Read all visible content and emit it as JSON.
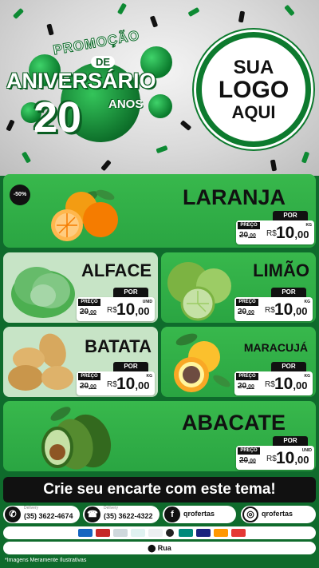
{
  "header": {
    "promo_title": "PROMOÇÃO",
    "promo_de": "DE",
    "promo_main": "ANIVERSÁRIO",
    "promo_number": "20",
    "promo_anos": "ANOS",
    "logo_line1": "SUA",
    "logo_line2": "LOGO",
    "logo_line3": "AQUI"
  },
  "products": [
    {
      "name": "LARANJA",
      "badge": "-50%",
      "por": "POR",
      "preco": "PREÇO",
      "old_price": "20",
      "old_cents": ",00",
      "currency": "R$",
      "price": "10",
      "cents": ",00",
      "unit": "KG"
    },
    {
      "name": "ALFACE",
      "por": "POR",
      "preco": "PREÇO",
      "old_price": "20",
      "old_cents": ",00",
      "currency": "R$",
      "price": "10",
      "cents": ",00",
      "unit": "UNID"
    },
    {
      "name": "LIMÃO",
      "por": "POR",
      "preco": "PREÇO",
      "old_price": "20",
      "old_cents": ",00",
      "currency": "R$",
      "price": "10",
      "cents": ",00",
      "unit": "KG"
    },
    {
      "name": "BATATA",
      "por": "POR",
      "preco": "PREÇO",
      "old_price": "20",
      "old_cents": ",00",
      "currency": "R$",
      "price": "10",
      "cents": ",00",
      "unit": "KG"
    },
    {
      "name": "MARACUJÁ",
      "por": "POR",
      "preco": "PREÇO",
      "old_price": "20",
      "old_cents": ",00",
      "currency": "R$",
      "price": "10",
      "cents": ",00",
      "unit": "KG"
    },
    {
      "name": "ABACATE",
      "por": "POR",
      "preco": "PREÇO",
      "old_price": "20",
      "old_cents": ",00",
      "currency": "R$",
      "price": "10",
      "cents": ",00",
      "unit": "UNID"
    }
  ],
  "cta": "Crie seu encarte com este tema!",
  "contacts": {
    "whatsapp_label": "Delivery",
    "whatsapp_value": "(35) 3622-4674",
    "phone_label": "Delivery",
    "phone_value": "(35) 3622-4322",
    "facebook": "qrofertas",
    "instagram": "qrofertas"
  },
  "address": "Rua",
  "disclaimer": "*Imagens Meramente Ilustrativas",
  "colors": {
    "brand_green": "#2fb24a",
    "dark_green": "#0f6b2c",
    "panel_light": "#c7e4c6",
    "black": "#111111"
  },
  "icons": [
    "whatsapp-icon",
    "phone-icon",
    "facebook-icon",
    "instagram-icon",
    "location-pin-icon"
  ]
}
